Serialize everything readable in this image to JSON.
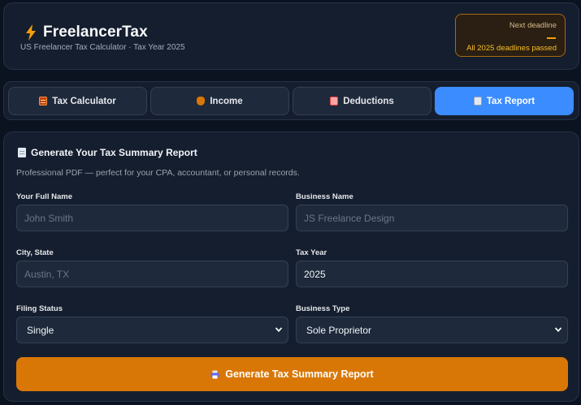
{
  "header": {
    "title": "FreelancerTax",
    "subtitle": "US Freelancer Tax Calculator · Tax Year 2025",
    "deadline_label": "Next deadline",
    "deadline_value": "—",
    "deadline_status": "All 2025 deadlines passed"
  },
  "tabs": [
    {
      "label": "Tax Calculator",
      "icon": "calculator-icon",
      "active": false
    },
    {
      "label": "Income",
      "icon": "money-bag-icon",
      "active": false
    },
    {
      "label": "Deductions",
      "icon": "receipt-icon",
      "active": false
    },
    {
      "label": "Tax Report",
      "icon": "document-icon",
      "active": true
    }
  ],
  "report": {
    "title": "Generate Your Tax Summary Report",
    "description": "Professional PDF — perfect for your CPA, accountant, or personal records.",
    "fields": {
      "full_name": {
        "label": "Your Full Name",
        "value": "",
        "placeholder": "John Smith"
      },
      "business_name": {
        "label": "Business Name",
        "value": "",
        "placeholder": "JS Freelance Design"
      },
      "city_state": {
        "label": "City, State",
        "value": "",
        "placeholder": "Austin, TX"
      },
      "tax_year": {
        "label": "Tax Year",
        "value": "2025",
        "placeholder": ""
      },
      "filing_status": {
        "label": "Filing Status",
        "value": "Single"
      },
      "business_type": {
        "label": "Business Type",
        "value": "Sole Proprietor"
      }
    },
    "generate_label": "Generate Tax Summary Report"
  },
  "colors": {
    "accent": "#3b8cff",
    "primary_action": "#d97706",
    "warning": "#fbbf24",
    "background": "#0b1220",
    "panel": "#151e2e"
  }
}
